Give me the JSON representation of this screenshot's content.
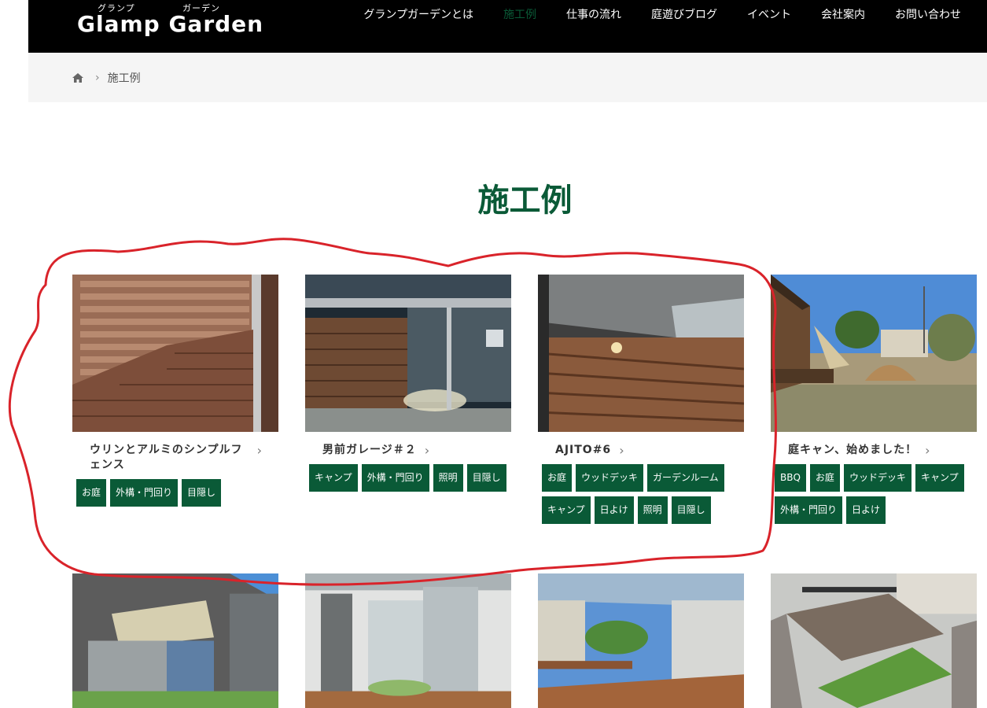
{
  "header": {
    "logo_ruby_1": "グランプ",
    "logo_ruby_2": "ガーデン",
    "logo_name": "Glamp Garden",
    "nav": [
      {
        "label": "グランプガーデンとは",
        "active": false
      },
      {
        "label": "施工例",
        "active": true
      },
      {
        "label": "仕事の流れ",
        "active": false
      },
      {
        "label": "庭遊びブログ",
        "active": false
      },
      {
        "label": "イベント",
        "active": false
      },
      {
        "label": "会社案内",
        "active": false
      },
      {
        "label": "お問い合わせ",
        "active": false
      }
    ]
  },
  "breadcrumb": {
    "home_icon": "home-icon",
    "separator": "›",
    "current": "施工例"
  },
  "page_title": "施工例",
  "cards": [
    {
      "title": "ウリンとアルミのシンプルフェンス",
      "tags": [
        "お庭",
        "外構・門回り",
        "目隠し"
      ],
      "photo": "slat-fence-brick"
    },
    {
      "title": "男前ガレージ＃２",
      "tags": [
        "キャンプ",
        "外構・門回り",
        "照明",
        "目隠し"
      ],
      "photo": "garage-night"
    },
    {
      "title": "AJITO#6",
      "tags": [
        "お庭",
        "ウッドデッキ",
        "ガーデンルーム",
        "キャンプ",
        "日よけ",
        "照明",
        "目隠し"
      ],
      "photo": "wood-wall-light"
    },
    {
      "title": "庭キャン、始めました！",
      "tags": [
        "BBQ",
        "お庭",
        "ウッドデッキ",
        "キャンプ",
        "外構・門回り",
        "日よけ"
      ],
      "photo": "camp-tent-garden"
    },
    {
      "title": "",
      "tags": [],
      "photo": "awning-terrace"
    },
    {
      "title": "",
      "tags": [],
      "photo": "pergola-patio"
    },
    {
      "title": "",
      "tags": [],
      "photo": "deck-roof"
    },
    {
      "title": "",
      "tags": [],
      "photo": "fenced-yard-aerial"
    }
  ],
  "colors": {
    "brand_green": "#0a5a37",
    "header_bg": "#000000",
    "breadcrumb_bg": "#f5f5f5",
    "annotation_red": "#d9232a"
  },
  "chevron": "›"
}
